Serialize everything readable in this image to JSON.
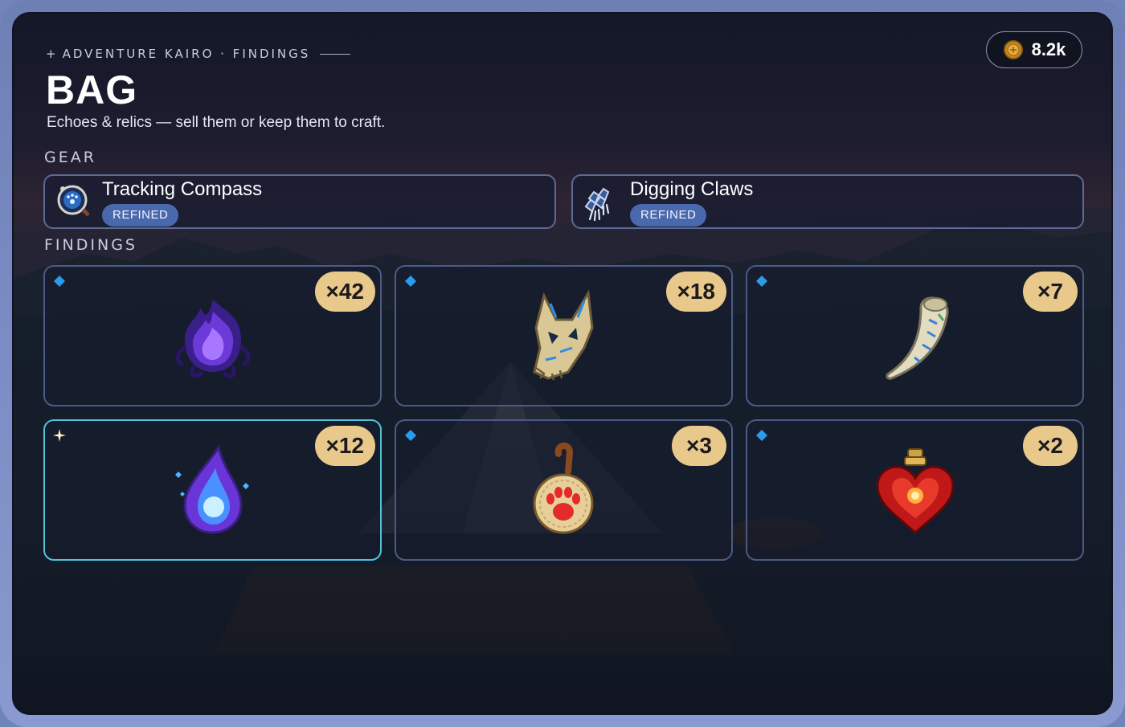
{
  "header": {
    "breadcrumb": "ADVENTURE KAIRO · FINDINGS",
    "title": "BAG",
    "subtitle": "Echoes & relics — sell them or keep them to craft."
  },
  "currency": {
    "value": "8.2k",
    "icon": "gold-coin-icon"
  },
  "gear": {
    "label": "GEAR",
    "items": [
      {
        "name": "Tracking Compass",
        "badge": "REFINED",
        "icon": "compass-icon"
      },
      {
        "name": "Digging Claws",
        "badge": "REFINED",
        "icon": "claws-icon"
      }
    ]
  },
  "findings": {
    "label": "FINDINGS",
    "items": [
      {
        "item": "purple-spirit-flame",
        "quantity": "×42",
        "marker": "blue-diamond"
      },
      {
        "item": "wolf-skull",
        "quantity": "×18",
        "marker": "blue-diamond"
      },
      {
        "item": "carved-horn",
        "quantity": "×7",
        "marker": "blue-diamond"
      },
      {
        "item": "spirit-droplet",
        "quantity": "×12",
        "marker": "sparkle",
        "selected": true
      },
      {
        "item": "paw-amulet",
        "quantity": "×3",
        "marker": "blue-diamond"
      },
      {
        "item": "heart-potion",
        "quantity": "×2",
        "marker": "blue-diamond"
      }
    ]
  },
  "colors": {
    "accent": "#e8c98b",
    "badge": "#4a68ac",
    "selected_border": "#4ec3d9",
    "frame": "#7c8cc4"
  }
}
